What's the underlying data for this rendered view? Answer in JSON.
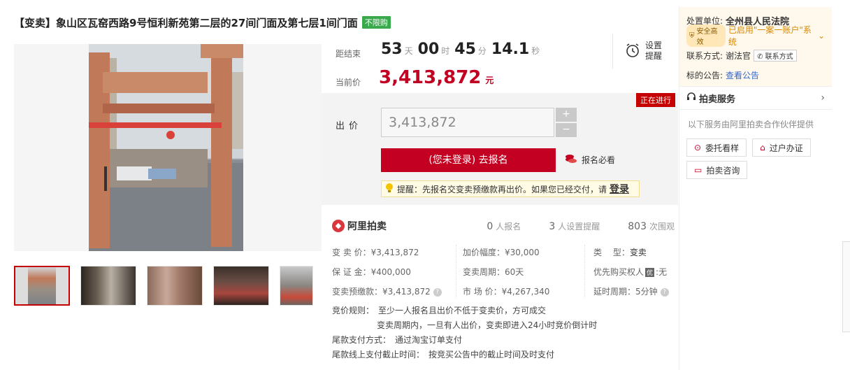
{
  "title": {
    "text": "【变卖】象山区瓦窑西路9号恒利新苑第二层的27间门面及第七层1间门面",
    "tag": "不限购"
  },
  "countdown": {
    "label": "距结束",
    "days": "53",
    "days_unit": "天",
    "hours": "00",
    "hours_unit": "时",
    "minutes": "45",
    "minutes_unit": "分",
    "seconds": "14.1",
    "seconds_unit": "秒"
  },
  "remind": {
    "label": "设置提醒"
  },
  "current_price": {
    "label": "当前价",
    "value": "3,413,872",
    "unit": "元"
  },
  "bid": {
    "status": "正在进行",
    "label": "出价",
    "input_value": "3,413,872",
    "plus": "+",
    "minus": "−",
    "signup_label": "(您未登录) 去报名",
    "must_read": "报名必看",
    "tip_text": "提醒：先报名交变卖预缴款再出价。如果您已经交付，请",
    "tip_link": "登录"
  },
  "info": {
    "logo_text": "阿里拍卖",
    "signups_num": "0",
    "signups_label": "人报名",
    "reminders_num": "3",
    "reminders_label": "人设置提醒",
    "views_num": "803",
    "views_label": "次围观",
    "cells": [
      {
        "key": "变 卖 价：",
        "val": "¥3,413,872"
      },
      {
        "key": "加价幅度：",
        "val": "¥30,000"
      },
      {
        "key": "类　 型：",
        "val": "变卖"
      },
      {
        "key": "保 证 金：",
        "val": "¥400,000"
      },
      {
        "key": "变卖周期：",
        "val": "60天"
      },
      {
        "key": "优先购买权人",
        "val": "无"
      },
      {
        "key": "变卖预缴款：",
        "val": "¥3,413,872"
      },
      {
        "key": "市 场 价：",
        "val": "¥4,267,340"
      },
      {
        "key": "延时周期：",
        "val": "5分钟"
      }
    ],
    "priority_badge": "优",
    "rules": [
      {
        "label": "竞价规则：",
        "text": "至少一人报名且出价不低于变卖价，方可成交"
      },
      {
        "label": "",
        "text": "变卖周期内，一旦有人出价，变卖即进入24小时竞价倒计时"
      },
      {
        "label": "尾款支付方式：",
        "text": "通过淘宝订单支付"
      },
      {
        "label": "尾款线上支付截止时间：",
        "text": "按竞买公告中的截止时间及时支付"
      }
    ]
  },
  "right": {
    "unit_label": "处置单位:",
    "unit_value": "全州县人民法院",
    "safe_badge": "安全高效",
    "system_text": "已启用\"一案一账户\"系统",
    "contact_label": "联系方式:",
    "contact_name": "谢法官",
    "contact_btn": "联系方式",
    "notice_label": "标的公告:",
    "notice_link": "查看公告",
    "service_title": "拍卖服务",
    "service_sub": "以下服务由阿里拍卖合作伙伴提供",
    "services": [
      "委托看样",
      "过户办证",
      "拍卖咨询"
    ]
  },
  "colors": {
    "accent_red": "#c40022",
    "tag_green": "#3aa94c",
    "link_blue": "#3366cc"
  }
}
